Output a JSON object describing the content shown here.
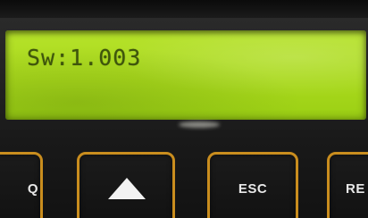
{
  "display": {
    "text": "Sw:1.003"
  },
  "keys": {
    "left_label": "Q",
    "up_icon": "up-arrow-icon",
    "esc_label": "ESC",
    "right_label": "RE"
  },
  "colors": {
    "lcd_background": "#a9d91c",
    "lcd_text": "#33480a",
    "key_border": "#c98d1e",
    "panel": "#141414"
  }
}
